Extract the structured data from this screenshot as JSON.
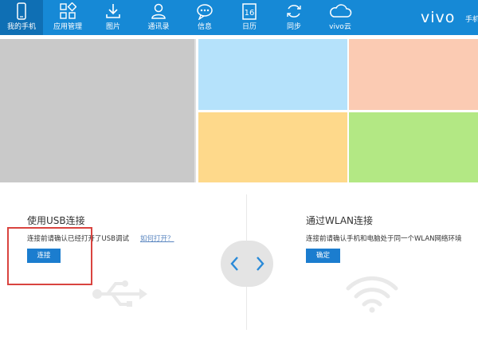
{
  "toolbar": {
    "tabs": [
      {
        "label": "我的手机",
        "icon": "phone-icon"
      },
      {
        "label": "应用管理",
        "icon": "apps-icon"
      },
      {
        "label": "图片",
        "icon": "download-icon"
      },
      {
        "label": "通讯录",
        "icon": "contacts-icon"
      },
      {
        "label": "信息",
        "icon": "message-icon"
      },
      {
        "label": "日历",
        "icon": "calendar-icon",
        "badge": "16"
      },
      {
        "label": "同步",
        "icon": "sync-icon"
      },
      {
        "label": "vivo云",
        "icon": "cloud-icon"
      }
    ],
    "brand": {
      "logo": "vivo",
      "suffix": "手机"
    },
    "accent": "#1689d6"
  },
  "tiles": {
    "colors": [
      "#c9c9c9",
      "#b5e2fb",
      "#fbcbb3",
      "#fed98b",
      "#b3e884"
    ]
  },
  "usb": {
    "title": "使用USB连接",
    "description": "连接前请确认已经打开了USB调试",
    "help_link": "如何打开？",
    "button": "连接",
    "icon": "usb-icon"
  },
  "wlan": {
    "title": "通过WLAN连接",
    "description": "连接前请确认手机和电脑处于同一个WLAN网络环境",
    "button": "确定",
    "icon": "wifi-icon"
  },
  "nav": {
    "prev_icon": "chevron-left-icon",
    "next_icon": "chevron-right-icon"
  }
}
